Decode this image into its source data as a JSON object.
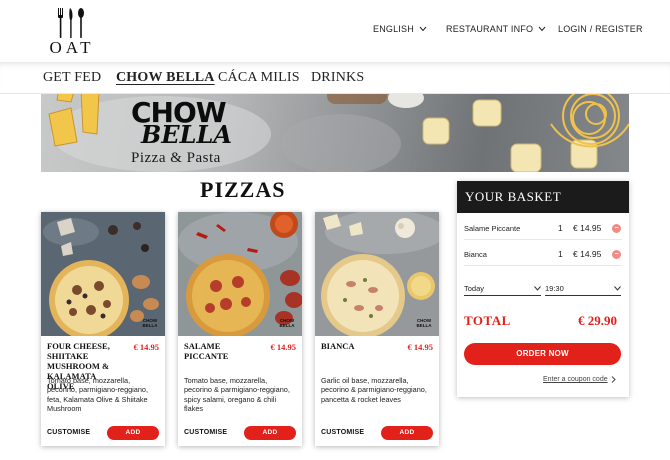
{
  "header": {
    "logo_text": "OAT",
    "language": "ENGLISH",
    "restaurant_info": "RESTAURANT INFO",
    "login": "LOGIN / REGISTER"
  },
  "categories": [
    {
      "label": "GET FED",
      "active": false
    },
    {
      "label": "CHOW BELLA",
      "active": true
    },
    {
      "label": "CÁCA MILIS",
      "active": false
    },
    {
      "label": "DRINKS",
      "active": false
    }
  ],
  "banner": {
    "title_line1": "CHOW",
    "title_line2": "BELLA",
    "subtitle": "Pizza & Pasta"
  },
  "section_title": "PIZZAS",
  "products": [
    {
      "name": "FOUR CHEESE, SHIITAKE MUSHROOM & KALAMATA OLIVE",
      "price": "€ 14.95",
      "description": "Tomato base, mozzarella, pecorino, parmigiano-reggiano, feta, Kalamata Olive & Shiitake Mushroom",
      "customise_label": "CUSTOMISE",
      "add_label": "ADD",
      "badge": "CHOW BELLA"
    },
    {
      "name": "SALAME PICCANTE",
      "price": "€ 14.95",
      "description": "Tomato base, mozzarella, pecorino & parmigiano-reggiano, spicy salami, oregano & chili flakes",
      "customise_label": "CUSTOMISE",
      "add_label": "ADD",
      "badge": "CHOW BELLA"
    },
    {
      "name": "BIANCA",
      "price": "€ 14.95",
      "description": "Garlic oil base, mozzarella, pecorino & parmigiano-reggiano, pancetta & rocket leaves",
      "customise_label": "CUSTOMISE",
      "add_label": "ADD",
      "badge": "CHOW BELLA"
    }
  ],
  "basket": {
    "title": "YOUR BASKET",
    "items": [
      {
        "name": "Salame Piccante",
        "qty": "1",
        "price": "€ 14.95"
      },
      {
        "name": "Bianca",
        "qty": "1",
        "price": "€ 14.95"
      }
    ],
    "day": "Today",
    "time": "19:30",
    "total_label": "TOTAL",
    "total_value": "€ 29.90",
    "order_label": "ORDER NOW",
    "coupon_label": "Enter a coupon code"
  },
  "colors": {
    "accent": "#e3211b",
    "basket_header": "#1b1b1b"
  }
}
